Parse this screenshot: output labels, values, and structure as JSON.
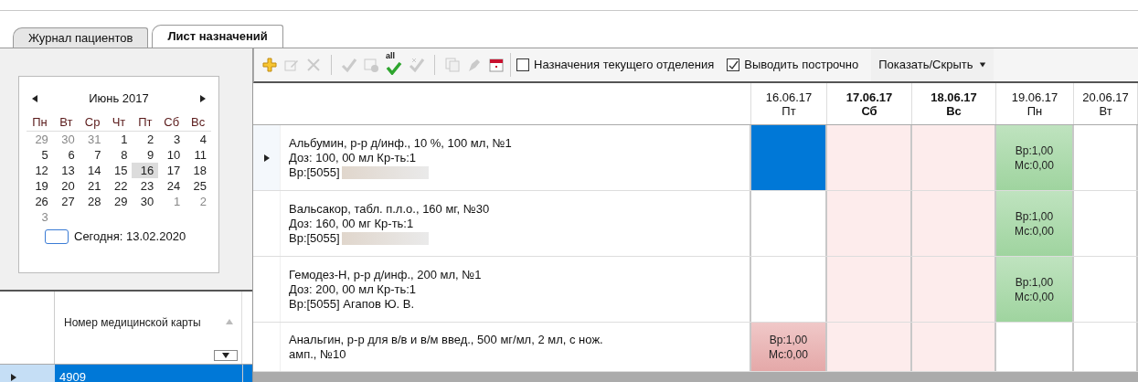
{
  "tabs": [
    {
      "label": "Журнал пациентов",
      "selected": false
    },
    {
      "label": "Лист назначений",
      "selected": true
    }
  ],
  "calendar": {
    "month": "Июнь 2017",
    "weekdays": [
      "Пн",
      "Вт",
      "Ср",
      "Чт",
      "Пт",
      "Сб",
      "Вс"
    ],
    "days": [
      {
        "label": "29",
        "other_month": true,
        "selected": false
      },
      {
        "label": "30",
        "other_month": true,
        "selected": false
      },
      {
        "label": "31",
        "other_month": true,
        "selected": false
      },
      {
        "label": "1",
        "other_month": false,
        "selected": false
      },
      {
        "label": "2",
        "other_month": false,
        "selected": false
      },
      {
        "label": "3",
        "other_month": false,
        "selected": false
      },
      {
        "label": "4",
        "other_month": false,
        "selected": false
      },
      {
        "label": "5",
        "other_month": false,
        "selected": false
      },
      {
        "label": "6",
        "other_month": false,
        "selected": false
      },
      {
        "label": "7",
        "other_month": false,
        "selected": false
      },
      {
        "label": "8",
        "other_month": false,
        "selected": false
      },
      {
        "label": "9",
        "other_month": false,
        "selected": false
      },
      {
        "label": "10",
        "other_month": false,
        "selected": false
      },
      {
        "label": "11",
        "other_month": false,
        "selected": false
      },
      {
        "label": "12",
        "other_month": false,
        "selected": false
      },
      {
        "label": "13",
        "other_month": false,
        "selected": false
      },
      {
        "label": "14",
        "other_month": false,
        "selected": false
      },
      {
        "label": "15",
        "other_month": false,
        "selected": false
      },
      {
        "label": "16",
        "other_month": false,
        "selected": true
      },
      {
        "label": "17",
        "other_month": false,
        "selected": false
      },
      {
        "label": "18",
        "other_month": false,
        "selected": false
      },
      {
        "label": "19",
        "other_month": false,
        "selected": false
      },
      {
        "label": "20",
        "other_month": false,
        "selected": false
      },
      {
        "label": "21",
        "other_month": false,
        "selected": false
      },
      {
        "label": "22",
        "other_month": false,
        "selected": false
      },
      {
        "label": "23",
        "other_month": false,
        "selected": false
      },
      {
        "label": "24",
        "other_month": false,
        "selected": false
      },
      {
        "label": "25",
        "other_month": false,
        "selected": false
      },
      {
        "label": "26",
        "other_month": false,
        "selected": false
      },
      {
        "label": "27",
        "other_month": false,
        "selected": false
      },
      {
        "label": "28",
        "other_month": false,
        "selected": false
      },
      {
        "label": "29",
        "other_month": false,
        "selected": false
      },
      {
        "label": "30",
        "other_month": false,
        "selected": false
      },
      {
        "label": "1",
        "other_month": true,
        "selected": false
      },
      {
        "label": "2",
        "other_month": true,
        "selected": false
      },
      {
        "label": "3",
        "other_month": true,
        "selected": false
      }
    ],
    "today": "Сегодня: 13.02.2020"
  },
  "patients_table": {
    "columns": [
      "Номер медицинской карты"
    ],
    "rows": [
      {
        "cells": [
          "4909"
        ],
        "selected": true
      }
    ]
  },
  "toolbar": {
    "tools": [
      {
        "kind": "add",
        "disabled": false
      },
      {
        "kind": "edit",
        "disabled": true
      },
      {
        "kind": "delete",
        "disabled": true
      },
      {
        "kind": "separator"
      },
      {
        "kind": "check",
        "disabled": true
      },
      {
        "kind": "form-check",
        "disabled": true
      },
      {
        "kind": "check-all",
        "disabled": false,
        "label": "all"
      },
      {
        "kind": "uncheck",
        "disabled": true
      },
      {
        "kind": "separator"
      },
      {
        "kind": "copy",
        "disabled": true
      },
      {
        "kind": "stamp",
        "disabled": true
      },
      {
        "kind": "calendar",
        "disabled": false
      }
    ],
    "checkboxes": [
      {
        "label": "Назначения текущего отделения",
        "checked": false
      },
      {
        "label": "Выводить построчно",
        "checked": true
      }
    ],
    "dropdown": "Показать/Скрыть"
  },
  "schedule": {
    "dates": [
      {
        "date": "16.06.17",
        "day": "Пт",
        "weekend": false
      },
      {
        "date": "17.06.17",
        "day": "Сб",
        "weekend": true
      },
      {
        "date": "18.06.17",
        "day": "Вс",
        "weekend": true
      },
      {
        "date": "19.06.17",
        "day": "Пн",
        "weekend": false
      },
      {
        "date": "20.06.17",
        "day": "Вт",
        "weekend": false
      }
    ],
    "rows": [
      {
        "current": true,
        "lines": [
          "Альбумин, р-р д/инф., 10 %, 100 мл, №1",
          "Доз: 100, 00 мл Кр-ть:1",
          "Вр:[5055]"
        ],
        "name_redacted": true,
        "cells": [
          {
            "kind": "selected"
          },
          {
            "kind": "empty"
          },
          {
            "kind": "empty"
          },
          {
            "kind": "done",
            "lines": [
              "Вр:1,00",
              "Мс:0,00"
            ]
          },
          {
            "kind": "empty"
          }
        ]
      },
      {
        "current": false,
        "lines": [
          "Вальсакор, табл. п.л.о., 160 мг, №30",
          "Доз: 160, 00 мг Кр-ть:1",
          "Вр:[5055]"
        ],
        "name_redacted": true,
        "cells": [
          {
            "kind": "empty"
          },
          {
            "kind": "empty"
          },
          {
            "kind": "empty"
          },
          {
            "kind": "done",
            "lines": [
              "Вр:1,00",
              "Мс:0,00"
            ]
          },
          {
            "kind": "empty"
          }
        ]
      },
      {
        "current": false,
        "lines": [
          "Гемодез-Н, р-р д/инф., 200 мл, №1",
          "Доз: 200, 00 мл Кр-ть:1",
          "Вр:[5055] Агапов Ю. В."
        ],
        "name_redacted": false,
        "cells": [
          {
            "kind": "empty"
          },
          {
            "kind": "empty"
          },
          {
            "kind": "empty"
          },
          {
            "kind": "done",
            "lines": [
              "Вр:1,00",
              "Мс:0,00"
            ]
          },
          {
            "kind": "empty"
          }
        ]
      },
      {
        "current": false,
        "lines": [
          "Анальгин, р-р для в/в и в/м введ., 500 мг/мл, 2 мл, с нож.",
          "амп., №10"
        ],
        "name_redacted": false,
        "cells": [
          {
            "kind": "missed",
            "lines": [
              "Вр:1,00",
              "Мс:0,00"
            ]
          },
          {
            "kind": "empty"
          },
          {
            "kind": "empty"
          },
          {
            "kind": "empty"
          },
          {
            "kind": "empty"
          }
        ]
      }
    ]
  }
}
